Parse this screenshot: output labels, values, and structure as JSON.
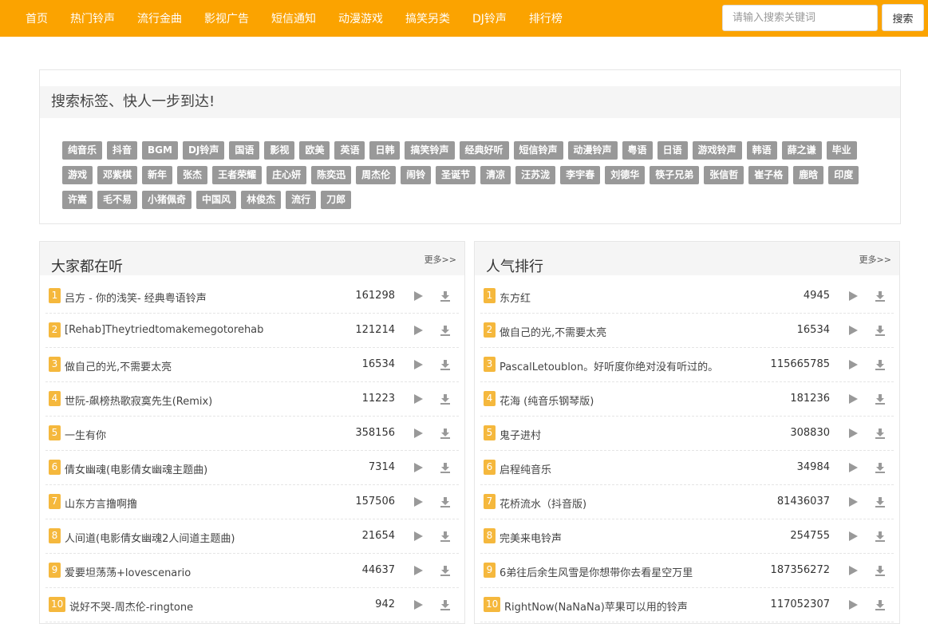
{
  "nav": [
    "首页",
    "热门铃声",
    "流行金曲",
    "影视广告",
    "短信通知",
    "动漫游戏",
    "搞笑另类",
    "DJ铃声",
    "排行榜"
  ],
  "search": {
    "placeholder": "请输入搜索关键词",
    "button": "搜索"
  },
  "tags_title": "搜索标签、快人一步到达!",
  "tags": [
    "纯音乐",
    "抖音",
    "BGM",
    "DJ铃声",
    "国语",
    "影视",
    "欧美",
    "英语",
    "日韩",
    "搞笑铃声",
    "经典好听",
    "短信铃声",
    "动漫铃声",
    "粤语",
    "日语",
    "游戏铃声",
    "韩语",
    "薛之谦",
    "毕业",
    "游戏",
    "邓紫棋",
    "新年",
    "张杰",
    "王者荣耀",
    "庄心妍",
    "陈奕迅",
    "周杰伦",
    "闹铃",
    "圣诞节",
    "清凉",
    "汪苏泷",
    "李宇春",
    "刘德华",
    "筷子兄弟",
    "张信哲",
    "崔子格",
    "鹿晗",
    "印度",
    "许嵩",
    "毛不易",
    "小猪佩奇",
    "中国风",
    "林俊杰",
    "流行",
    "刀郎"
  ],
  "panels": [
    {
      "title": "大家都在听",
      "more": "更多>>",
      "rows": [
        {
          "n": "1",
          "title": "吕方 - 你的浅笑-    经典粤语铃声",
          "count": "161298"
        },
        {
          "n": "2",
          "title": "[Rehab]Theytriedtomakemegotorehab",
          "count": "121214"
        },
        {
          "n": "3",
          "title": "做自己的光,不需要太亮",
          "count": "16534"
        },
        {
          "n": "4",
          "title": "世阮-飙榜热歌寂寞先生(Remix)",
          "count": "11223"
        },
        {
          "n": "5",
          "title": "一生有你",
          "count": "358156"
        },
        {
          "n": "6",
          "title": "倩女幽魂(电影倩女幽魂主题曲)",
          "count": "7314"
        },
        {
          "n": "7",
          "title": "山东方言撸啊撸",
          "count": "157506"
        },
        {
          "n": "8",
          "title": "人间道(电影倩女幽魂2人间道主题曲)",
          "count": "21654"
        },
        {
          "n": "9",
          "title": "爱要坦荡荡+lovescenario",
          "count": "44637"
        },
        {
          "n": "10",
          "title": "说好不哭-周杰伦-ringtone",
          "count": "942"
        }
      ]
    },
    {
      "title": "人气排行",
      "more": "更多>>",
      "rows": [
        {
          "n": "1",
          "title": "东方红",
          "count": "4945"
        },
        {
          "n": "2",
          "title": "做自己的光,不需要太亮",
          "count": "16534"
        },
        {
          "n": "3",
          "title": "PascalLetoublon。好听度你绝对没有听过的。",
          "count": "115665785"
        },
        {
          "n": "4",
          "title": "花海 (纯音乐钢琴版)",
          "count": "181236"
        },
        {
          "n": "5",
          "title": "鬼子进村",
          "count": "308830"
        },
        {
          "n": "6",
          "title": "启程纯音乐",
          "count": "34984"
        },
        {
          "n": "7",
          "title": "花桥流水（抖音版)",
          "count": "81436037"
        },
        {
          "n": "8",
          "title": "完美来电铃声",
          "count": "254755"
        },
        {
          "n": "9",
          "title": "6弟往后余生风雪是你想带你去看星空万里",
          "count": "187356272"
        },
        {
          "n": "10",
          "title": "RightNow(NaNaNa)苹果可以用的铃声",
          "count": "117052307"
        }
      ]
    }
  ]
}
